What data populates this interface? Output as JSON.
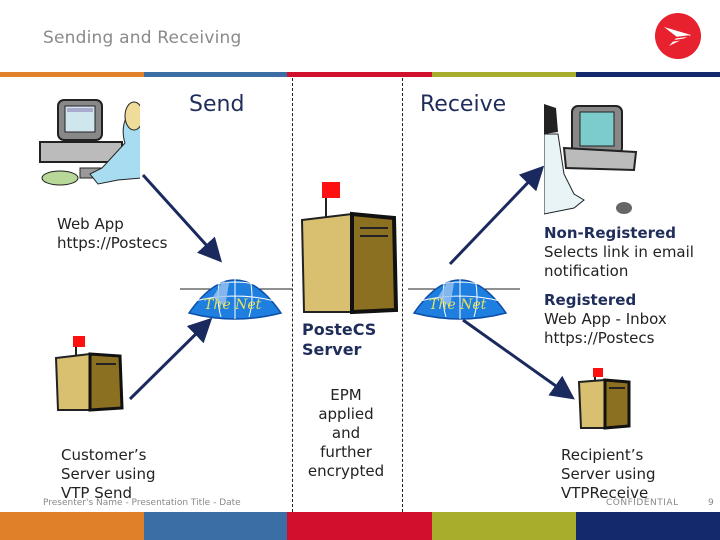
{
  "header": {
    "title": "Sending and Receiving",
    "logo": "canada-post-logo",
    "band_colors": [
      "#e08028",
      "#3a6ea5",
      "#d0102c",
      "#a8ad2c",
      "#13296b"
    ]
  },
  "columns": {
    "send_label": "Send",
    "receive_label": "Receive"
  },
  "sender": {
    "web_app_line1": "Web App",
    "web_app_line2": "https://Postecs",
    "server_line1": "Customer’s",
    "server_line2": "Server using",
    "server_line3": "VTP Send"
  },
  "network": {
    "left_globe_label": "The Net",
    "right_globe_label": "The Net"
  },
  "center": {
    "server_line1": "PosteCS",
    "server_line2": "Server",
    "note_line1": "EPM",
    "note_line2": "applied",
    "note_line3": "and",
    "note_line4": "further",
    "note_line5": "encrypted"
  },
  "receiver": {
    "nonreg_title": "Non-Registered",
    "nonreg_line1": "Selects link in email",
    "nonreg_line2": "notification",
    "reg_title": "Registered",
    "reg_line1": "Web App - Inbox",
    "reg_line2": "https://Postecs",
    "server_line1": "Recipient’s",
    "server_line2": "Server using",
    "server_line3": "VTPReceive"
  },
  "footer": {
    "presenter": "Presenter's Name - Presentation Title - Date",
    "confidential": "CONFIDENTIAL",
    "page_number": "9"
  }
}
